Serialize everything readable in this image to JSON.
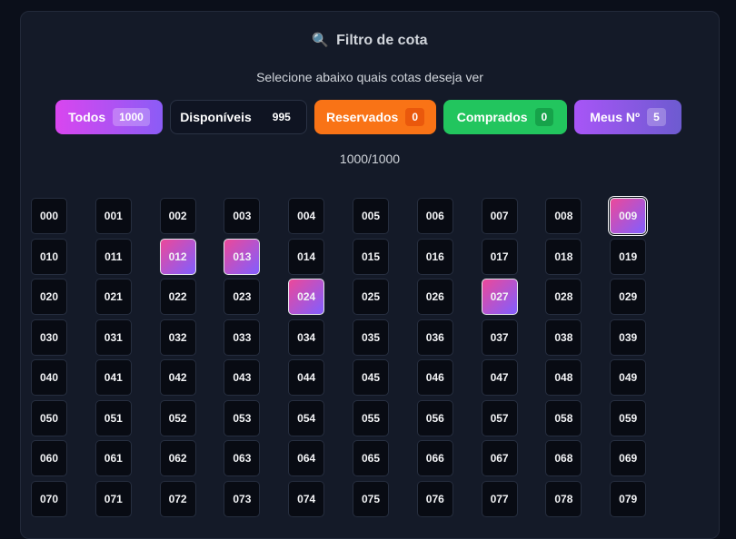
{
  "filter": {
    "title": "Filtro de cota",
    "subtitle": "Selecione abaixo quais cotas deseja ver",
    "buttons": {
      "todos": {
        "label": "Todos",
        "count": "1000"
      },
      "disponiveis": {
        "label": "Disponíveis",
        "count": "995"
      },
      "reservados": {
        "label": "Reservados",
        "count": "0"
      },
      "comprados": {
        "label": "Comprados",
        "count": "0"
      },
      "meus": {
        "label": "Meus Nº",
        "count": "5"
      }
    },
    "total": "1000/1000"
  },
  "numbers": {
    "columns": 10,
    "visible_rows": 8,
    "selected": [
      "009",
      "012",
      "013",
      "024",
      "027"
    ],
    "outlined": [
      "009"
    ]
  },
  "colors": {
    "todos": "#d946ef",
    "reservados": "#f97316",
    "comprados": "#22c55e",
    "meus": "#a855f7",
    "selected_gradient_start": "#ec4899",
    "selected_gradient_end": "#8b5cf6"
  }
}
